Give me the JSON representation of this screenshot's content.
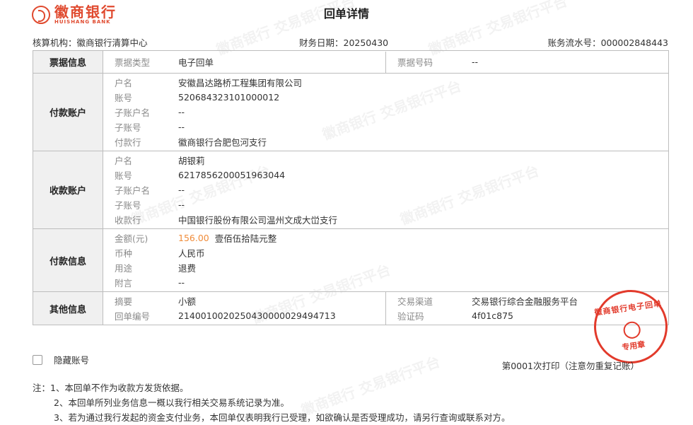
{
  "header": {
    "bank_name": "徽商银行",
    "bank_name_en": "HUISHANG BANK",
    "title": "回单详情"
  },
  "meta": {
    "institution": "核算机构：徽商银行清算中心",
    "finance_date": "财务日期：20250430",
    "serial_no": "账务流水号：000002848443"
  },
  "bill_info": {
    "section": "票据信息",
    "type_label": "票据类型",
    "type_value": "电子回单",
    "number_label": "票据号码",
    "number_value": "--"
  },
  "payer": {
    "section": "付款账户",
    "rows": [
      {
        "label": "户名",
        "value": "安徽昌达路桥工程集团有限公司"
      },
      {
        "label": "账号",
        "value": "520684323101000012"
      },
      {
        "label": "子账户名",
        "value": "--"
      },
      {
        "label": "子账号",
        "value": "--"
      },
      {
        "label": "付款行",
        "value": "徽商银行合肥包河支行"
      }
    ]
  },
  "payee": {
    "section": "收款账户",
    "rows": [
      {
        "label": "户名",
        "value": "胡银莉"
      },
      {
        "label": "账号",
        "value": "6217856200051963044"
      },
      {
        "label": "子账户名",
        "value": "--"
      },
      {
        "label": "子账号",
        "value": "--"
      },
      {
        "label": "收款行",
        "value": "中国银行股份有限公司温州文成大峃支行"
      }
    ]
  },
  "payment": {
    "section": "付款信息",
    "amount_label": "金额(元)",
    "amount_number": "156.00",
    "amount_words": "壹佰伍拾陆元整",
    "currency_label": "币种",
    "currency_value": "人民币",
    "purpose_label": "用途",
    "purpose_value": "退费",
    "note_label": "附言",
    "note_value": "--"
  },
  "other": {
    "section": "其他信息",
    "summary_label": "摘要",
    "summary_value": "小额",
    "receipt_no_label": "回单编号",
    "receipt_no_value": "2140010020250430000029494713",
    "channel_label": "交易渠道",
    "channel_value": "交易银行综合金融服务平台",
    "code_label": "验证码",
    "code_value": "4f01c875"
  },
  "hide_account": "隐藏账号",
  "print_count": "第0001次打印（注意勿重复记账）",
  "notes": [
    "注：1、本回单不作为收款方发货依据。",
    "2、本回单所列业务信息一概以我行相关交易系统记录为准。",
    "3、若为通过我行发起的资金支付业务，本回单仅表明我行已受理，如欲确认是否受理成功，请另行查询或联系对方。"
  ],
  "stamp": {
    "top": "徽商银行电子回单",
    "bottom": "专用章"
  },
  "watermark": "徽商银行 交易银行平台",
  "colors": {
    "brand": "#e04a2f",
    "amount": "#f08c3a",
    "stamp": "#e23a2b",
    "section_bg": "#f0f0f0"
  }
}
